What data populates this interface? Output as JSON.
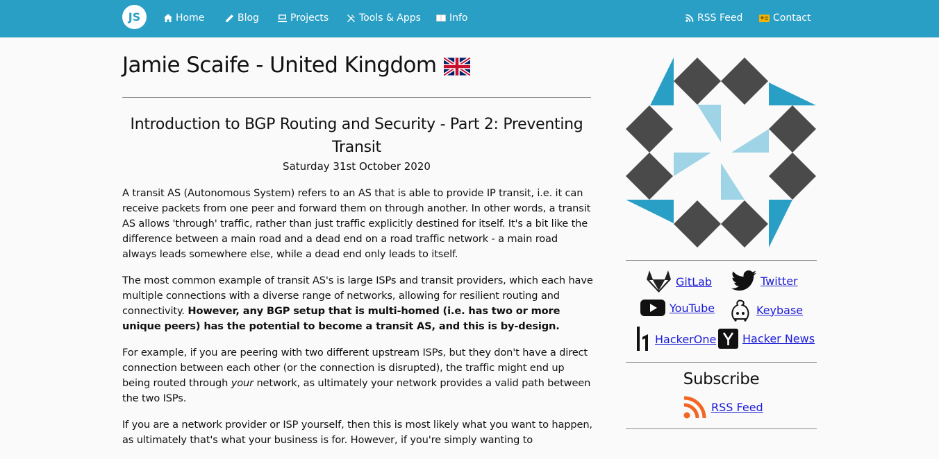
{
  "nav": {
    "logo_text": "JS",
    "home": "Home",
    "blog": "Blog",
    "projects": "Projects",
    "tools": "Tools & Apps",
    "info": "Info",
    "rss": "RSS Feed",
    "contact": "Contact",
    "icons": {
      "home": "house-icon",
      "blog": "pencil-icon",
      "projects": "computer-icon",
      "tools": "tools-icon",
      "info": "book-icon",
      "rss": "rss-icon",
      "contact": "id-card-icon"
    }
  },
  "header": {
    "title": "Jamie Scaife - United Kingdom",
    "flag": "uk-flag-icon"
  },
  "post": {
    "title": "Introduction to BGP Routing and Security - Part 2: Preventing Transit",
    "date": "Saturday 31st October 2020",
    "p1": "A transit AS (Autonomous System) refers to an AS that is able to provide IP transit, i.e. it can receive packets from one peer and forward them on through another. In other words, a transit AS allows 'through' traffic, rather than just traffic explicitly destined for itself. It's a bit like the difference between a main road and a dead end on a road traffic network - a main road always leads somewhere else, while a dead end only leads to itself.",
    "p2_start": "The most common example of transit AS's is large ISPs and transit providers, which each have multiple connections with a diverse range of networks, allowing for resilient routing and connectivity. ",
    "p2_bold": "However, any BGP setup that is multi-homed (i.e. has two or more unique peers) has the potential to become a transit AS, and this is by-design.",
    "p3_start": "For example, if you are peering with two different upstream ISPs, but they don't have a direct connection between each other (or the connection is disrupted), the traffic might end up being routed through ",
    "p3_em": "your",
    "p3_end": " network, as ultimately your network provides a valid path between the two ISPs.",
    "p4": "If you are a network provider or ISP yourself, then this is most likely what you want to happen, as ultimately that's what your business is for. However, if you're simply wanting to"
  },
  "sidebar": {
    "links": {
      "gitlab": "GitLab",
      "twitter": "Twitter",
      "youtube": "YouTube",
      "keybase": "Keybase",
      "hackerone": "HackerOne",
      "hackernews": "Hacker News"
    },
    "subscribe": {
      "heading": "Subscribe",
      "rss": "RSS Feed"
    }
  },
  "colors": {
    "nav_bg": "#2a9fc6",
    "link": "#1b1bd6",
    "accent_blue": "#2a9fc6",
    "light_blue": "#9fd3e6",
    "diamond": "#4a4a4a",
    "rss_orange": "#f26522"
  }
}
